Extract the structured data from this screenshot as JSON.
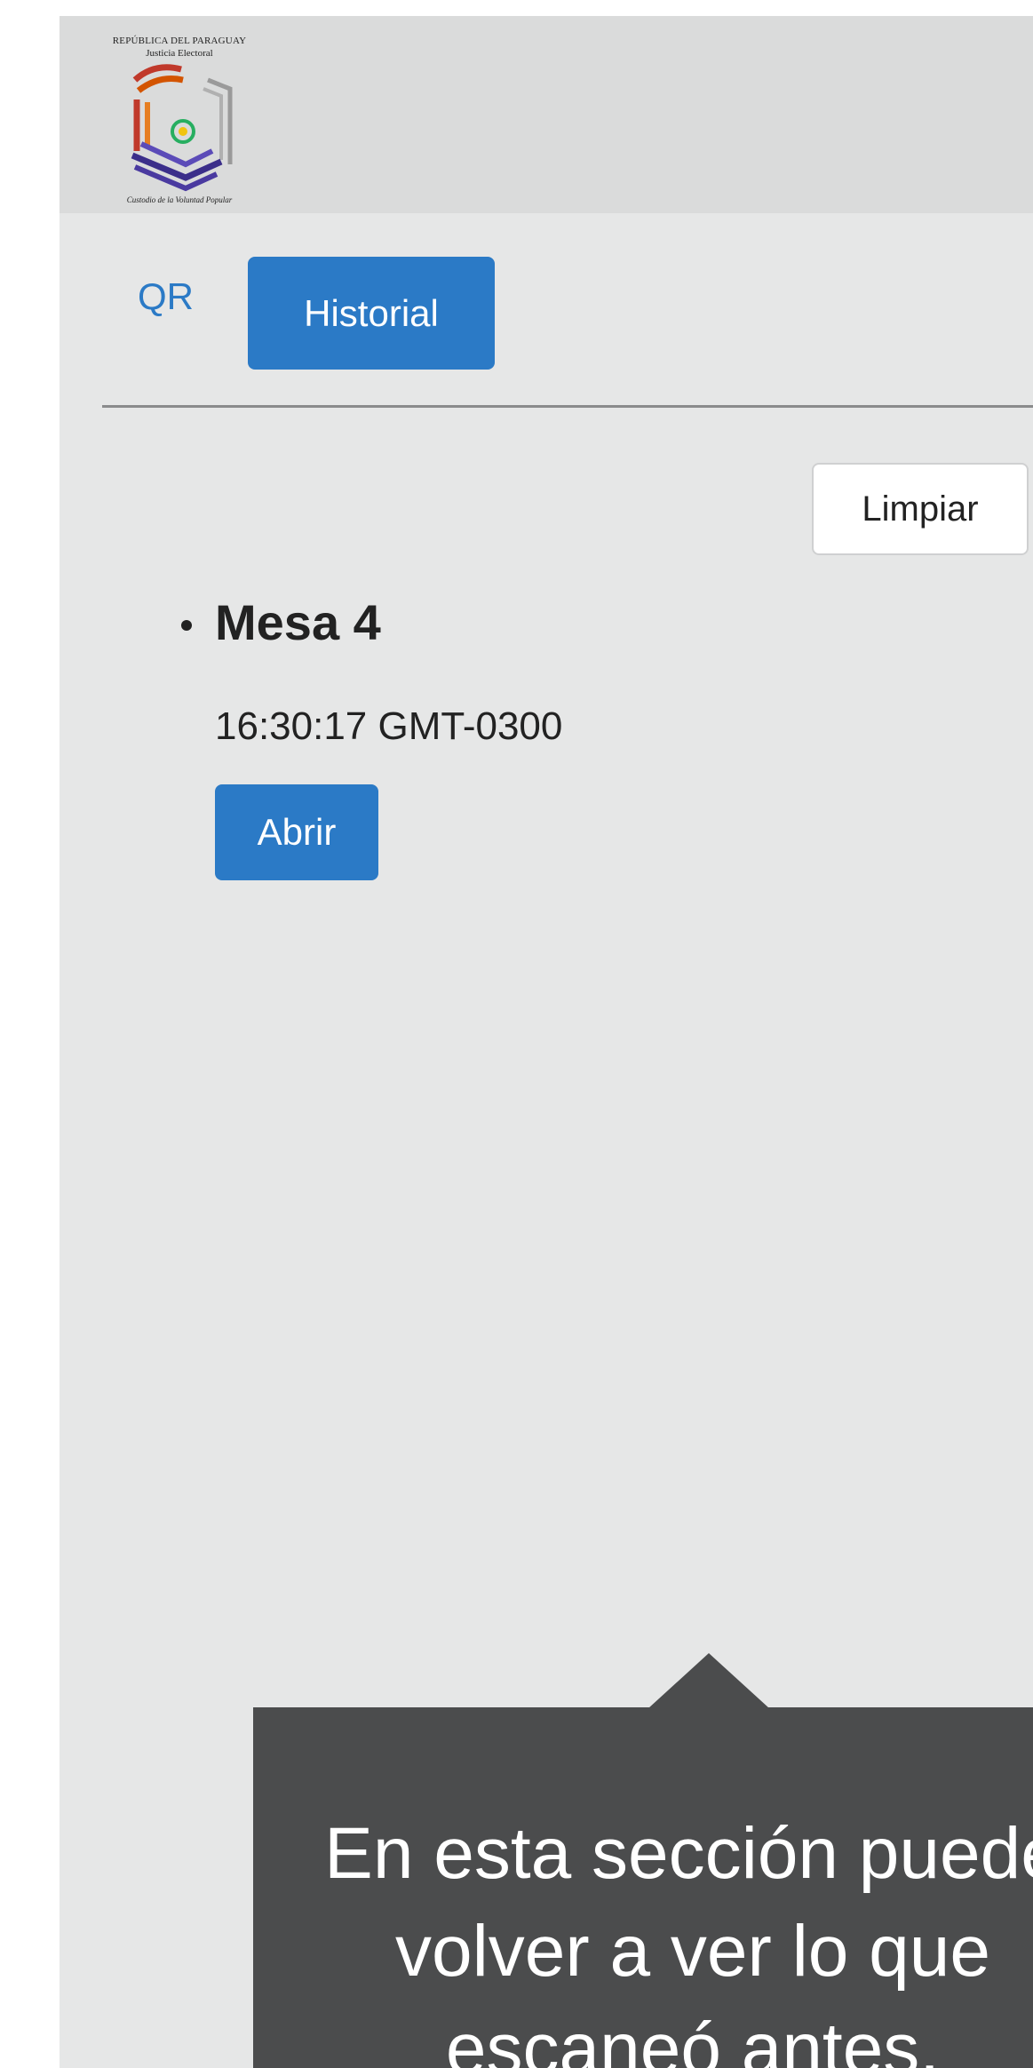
{
  "header": {
    "logo": {
      "line1": "REPÚBLICA DEL PARAGUAY",
      "line2": "Justicia Electoral",
      "motto": "Custodio de la Voluntad Popular",
      "icon": "justicia-electoral-logo"
    }
  },
  "tabs": [
    {
      "label": "QR",
      "active": false
    },
    {
      "label": "Historial",
      "active": true
    }
  ],
  "actions": {
    "clear_label": "Limpiar"
  },
  "history": [
    {
      "title": "Mesa 4",
      "time": "16:30:17 GMT-0300",
      "open_label": "Abrir"
    }
  ],
  "tooltip": {
    "text": "En esta sección puede volver a ver lo que escaneó antes."
  },
  "colors": {
    "accent": "#2b7ac6",
    "background": "#e6e7e7",
    "header": "#dadbdb",
    "tooltip": "#4b4c4d"
  }
}
